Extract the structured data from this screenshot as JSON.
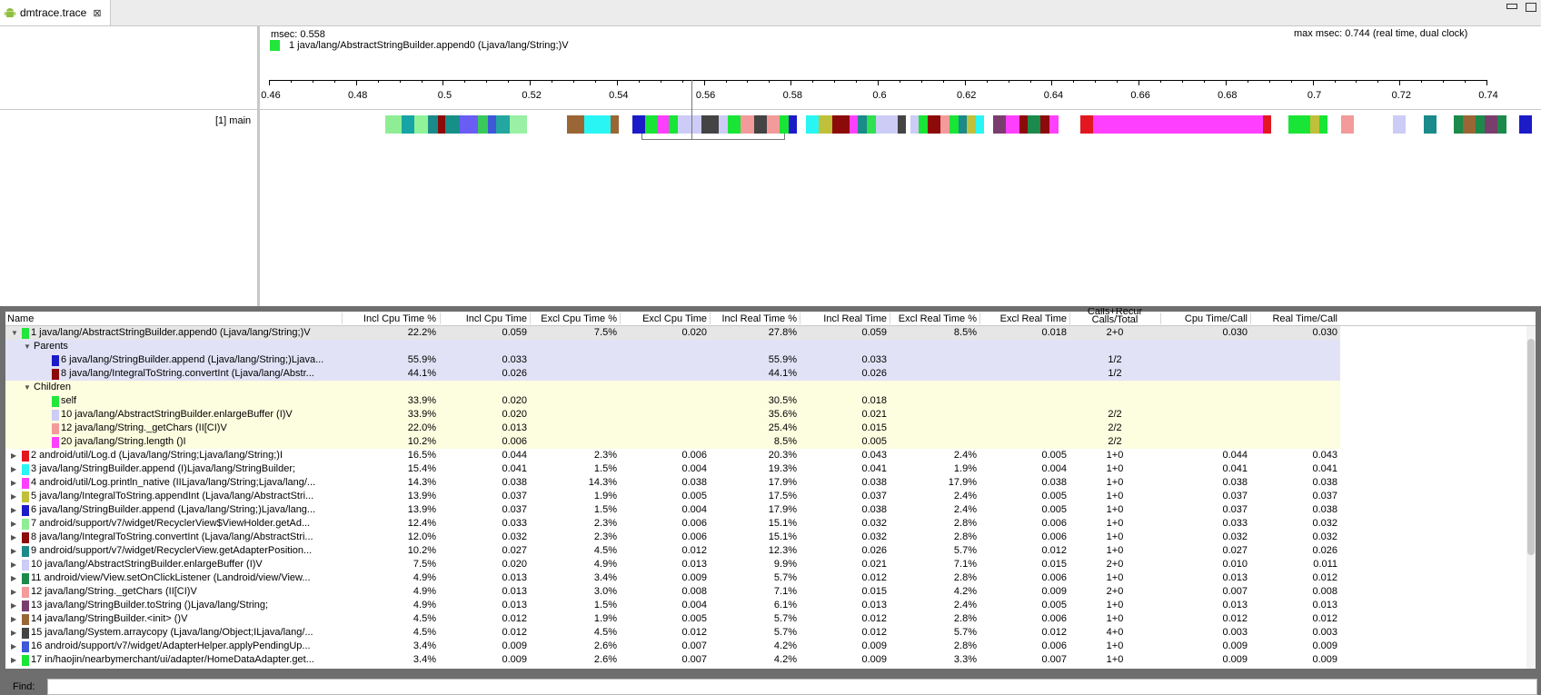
{
  "tab": {
    "title": "dmtrace.trace",
    "close": "⊠"
  },
  "header": {
    "msec": "msec: 0.558",
    "selected_color": "#22e63a",
    "selected_name": "1 java/lang/AbstractStringBuilder.append0 (Ljava/lang/String;)V",
    "max_msec": "max msec: 0.744 (real time, dual clock)"
  },
  "ruler_ticks": [
    "0.46",
    "0.48",
    "0.5",
    "0.52",
    "0.54",
    "0.56",
    "0.58",
    "0.6",
    "0.62",
    "0.64",
    "0.66",
    "0.68",
    "0.7",
    "0.72",
    "0.74"
  ],
  "thread_label": "[1] main",
  "segments": [
    [
      0.4868,
      0.4905,
      "#8fee93"
    ],
    [
      0.4905,
      0.4935,
      "#17a4a4"
    ],
    [
      0.4935,
      0.4965,
      "#90f39a"
    ],
    [
      0.4965,
      0.4988,
      "#1b8a8a"
    ],
    [
      0.4988,
      0.5005,
      "#8d0a0a"
    ],
    [
      0.5005,
      0.5038,
      "#168f88"
    ],
    [
      0.5038,
      0.508,
      "#6a5df3"
    ],
    [
      0.508,
      0.5103,
      "#39c95a"
    ],
    [
      0.5103,
      0.5123,
      "#3e58d8"
    ],
    [
      0.5123,
      0.5153,
      "#23a7a0"
    ],
    [
      0.5153,
      0.5193,
      "#9af0a4"
    ],
    [
      0.5285,
      0.5325,
      "#9a6635"
    ],
    [
      0.5325,
      0.5385,
      "#2af5f5"
    ],
    [
      0.5385,
      0.5405,
      "#9a6635"
    ],
    [
      0.5435,
      0.5465,
      "#1b1bc8"
    ],
    [
      0.5465,
      0.5495,
      "#18e535"
    ],
    [
      0.5495,
      0.552,
      "#ff3fff"
    ],
    [
      0.552,
      0.554,
      "#18e535"
    ],
    [
      0.554,
      0.5565,
      "#ccccf6"
    ],
    [
      0.5565,
      0.5595,
      "#ccccf6"
    ],
    [
      0.5595,
      0.5635,
      "#444444"
    ],
    [
      0.5635,
      0.5655,
      "#ccccf6"
    ],
    [
      0.5655,
      0.5685,
      "#18e535"
    ],
    [
      0.5685,
      0.5715,
      "#f39a9a"
    ],
    [
      0.5715,
      0.5745,
      "#444444"
    ],
    [
      0.5745,
      0.5775,
      "#f39a9a"
    ],
    [
      0.5775,
      0.5795,
      "#18e535"
    ],
    [
      0.5795,
      0.5815,
      "#1b1bc8"
    ],
    [
      0.5835,
      0.5865,
      "#2af5f5"
    ],
    [
      0.5865,
      0.5895,
      "#c0c03a"
    ],
    [
      0.5895,
      0.5935,
      "#8d0a0a"
    ],
    [
      0.5935,
      0.5955,
      "#ff3fff"
    ],
    [
      0.5955,
      0.5975,
      "#1b8a8a"
    ],
    [
      0.5975,
      0.5995,
      "#30e050"
    ],
    [
      0.5995,
      0.6045,
      "#ccccf6"
    ],
    [
      0.6045,
      0.6065,
      "#444444"
    ],
    [
      0.6075,
      0.6095,
      "#ccccf6"
    ],
    [
      0.6095,
      0.6115,
      "#18e535"
    ],
    [
      0.6115,
      0.6145,
      "#8d0a0a"
    ],
    [
      0.6145,
      0.6165,
      "#f39a9a"
    ],
    [
      0.6165,
      0.6185,
      "#18e535"
    ],
    [
      0.6185,
      0.6205,
      "#1b8a8a"
    ],
    [
      0.6205,
      0.6225,
      "#c0c03a"
    ],
    [
      0.6225,
      0.6245,
      "#2af5f5"
    ],
    [
      0.6265,
      0.6295,
      "#7a3e6e"
    ],
    [
      0.6295,
      0.6325,
      "#ff3fff"
    ],
    [
      0.6325,
      0.6345,
      "#8d0a0a"
    ],
    [
      0.6345,
      0.6375,
      "#1b8a4a"
    ],
    [
      0.6375,
      0.6395,
      "#8d0a0a"
    ],
    [
      0.6395,
      0.6415,
      "#ff3fff"
    ],
    [
      0.6465,
      0.6495,
      "#e2171f"
    ],
    [
      0.6495,
      0.6885,
      "#ff3fff"
    ],
    [
      0.6885,
      0.6905,
      "#e2171f"
    ],
    [
      0.6945,
      0.6995,
      "#18e535"
    ],
    [
      0.6995,
      0.7015,
      "#c0c03a"
    ],
    [
      0.7015,
      0.7035,
      "#18e535"
    ],
    [
      0.7065,
      0.7095,
      "#f39a9a"
    ],
    [
      0.7185,
      0.7215,
      "#ccccf6"
    ],
    [
      0.7255,
      0.7285,
      "#1b8a8a"
    ],
    [
      0.7325,
      0.7345,
      "#1b8a4a"
    ],
    [
      0.7345,
      0.7375,
      "#9a6635"
    ],
    [
      0.7375,
      0.7395,
      "#1b8a4a"
    ],
    [
      0.7395,
      0.7425,
      "#7a3e6e"
    ],
    [
      0.7425,
      0.7445,
      "#1b8a4a"
    ],
    [
      0.7475,
      0.7505,
      "#1b1bc8"
    ]
  ],
  "columns": {
    "name": "Name",
    "incl_cpu_pct": "Incl Cpu Time %",
    "incl_cpu": "Incl Cpu Time",
    "excl_cpu_pct": "Excl Cpu Time %",
    "excl_cpu": "Excl Cpu Time",
    "incl_real_pct": "Incl Real Time %",
    "incl_real": "Incl Real Time",
    "excl_real_pct": "Excl Real Time %",
    "excl_real": "Excl Real Time",
    "calls_line1": "Calls+Recur",
    "calls_line2": "Calls/Total",
    "cpu_per_call": "Cpu Time/Call",
    "real_per_call": "Real Time/Call"
  },
  "rows": [
    {
      "kind": "expanded",
      "bg": "#e6e6e6",
      "indent": 0,
      "color": "#22e63a",
      "name": "1 java/lang/AbstractStringBuilder.append0 (Ljava/lang/String;)V",
      "v": [
        "22.2%",
        "0.059",
        "7.5%",
        "0.020",
        "27.8%",
        "0.059",
        "8.5%",
        "0.018",
        "2+0",
        "0.030",
        "0.030"
      ]
    },
    {
      "kind": "group",
      "bg": "#e2e2f7",
      "indent": 1,
      "color": "",
      "name": "Parents",
      "v": [
        "",
        "",
        "",
        "",
        "",
        "",
        "",
        "",
        "",
        "",
        ""
      ]
    },
    {
      "kind": "leaf",
      "bg": "#e2e2f7",
      "indent": 2,
      "color": "#1b1bc8",
      "name": "6 java/lang/StringBuilder.append (Ljava/lang/String;)Ljava...",
      "v": [
        "55.9%",
        "0.033",
        "",
        "",
        "55.9%",
        "0.033",
        "",
        "",
        "1/2",
        "",
        ""
      ]
    },
    {
      "kind": "leaf",
      "bg": "#e2e2f7",
      "indent": 2,
      "color": "#8d0a0a",
      "name": "8 java/lang/IntegralToString.convertInt (Ljava/lang/Abstr...",
      "v": [
        "44.1%",
        "0.026",
        "",
        "",
        "44.1%",
        "0.026",
        "",
        "",
        "1/2",
        "",
        ""
      ]
    },
    {
      "kind": "group",
      "bg": "#fdfde0",
      "indent": 1,
      "color": "",
      "name": "Children",
      "v": [
        "",
        "",
        "",
        "",
        "",
        "",
        "",
        "",
        "",
        "",
        ""
      ]
    },
    {
      "kind": "leaf",
      "bg": "#fdfde0",
      "indent": 2,
      "color": "#22e63a",
      "name": "self",
      "v": [
        "33.9%",
        "0.020",
        "",
        "",
        "30.5%",
        "0.018",
        "",
        "",
        "",
        "",
        ""
      ]
    },
    {
      "kind": "leaf",
      "bg": "#fdfde0",
      "indent": 2,
      "color": "#ccccf6",
      "name": "10 java/lang/AbstractStringBuilder.enlargeBuffer (I)V",
      "v": [
        "33.9%",
        "0.020",
        "",
        "",
        "35.6%",
        "0.021",
        "",
        "",
        "2/2",
        "",
        ""
      ]
    },
    {
      "kind": "leaf",
      "bg": "#fdfde0",
      "indent": 2,
      "color": "#f39a9a",
      "name": "12 java/lang/String._getChars (II[CI)V",
      "v": [
        "22.0%",
        "0.013",
        "",
        "",
        "25.4%",
        "0.015",
        "",
        "",
        "2/2",
        "",
        ""
      ]
    },
    {
      "kind": "leaf",
      "bg": "#fdfde0",
      "indent": 2,
      "color": "#ff3fff",
      "name": "20 java/lang/String.length ()I",
      "v": [
        "10.2%",
        "0.006",
        "",
        "",
        "8.5%",
        "0.005",
        "",
        "",
        "2/2",
        "",
        ""
      ]
    },
    {
      "kind": "collapsed",
      "bg": "#ffffff",
      "indent": 0,
      "color": "#e2171f",
      "name": "2 android/util/Log.d (Ljava/lang/String;Ljava/lang/String;)I",
      "v": [
        "16.5%",
        "0.044",
        "2.3%",
        "0.006",
        "20.3%",
        "0.043",
        "2.4%",
        "0.005",
        "1+0",
        "0.044",
        "0.043"
      ]
    },
    {
      "kind": "collapsed",
      "bg": "#ffffff",
      "indent": 0,
      "color": "#2af5f5",
      "name": "3 java/lang/StringBuilder.append (I)Ljava/lang/StringBuilder;",
      "v": [
        "15.4%",
        "0.041",
        "1.5%",
        "0.004",
        "19.3%",
        "0.041",
        "1.9%",
        "0.004",
        "1+0",
        "0.041",
        "0.041"
      ]
    },
    {
      "kind": "collapsed",
      "bg": "#ffffff",
      "indent": 0,
      "color": "#ff3fff",
      "name": "4 android/util/Log.println_native (IILjava/lang/String;Ljava/lang/...",
      "v": [
        "14.3%",
        "0.038",
        "14.3%",
        "0.038",
        "17.9%",
        "0.038",
        "17.9%",
        "0.038",
        "1+0",
        "0.038",
        "0.038"
      ]
    },
    {
      "kind": "collapsed",
      "bg": "#ffffff",
      "indent": 0,
      "color": "#c0c03a",
      "name": "5 java/lang/IntegralToString.appendInt (Ljava/lang/AbstractStri...",
      "v": [
        "13.9%",
        "0.037",
        "1.9%",
        "0.005",
        "17.5%",
        "0.037",
        "2.4%",
        "0.005",
        "1+0",
        "0.037",
        "0.037"
      ]
    },
    {
      "kind": "collapsed",
      "bg": "#ffffff",
      "indent": 0,
      "color": "#1b1bc8",
      "name": "6 java/lang/StringBuilder.append (Ljava/lang/String;)Ljava/lang...",
      "v": [
        "13.9%",
        "0.037",
        "1.5%",
        "0.004",
        "17.9%",
        "0.038",
        "2.4%",
        "0.005",
        "1+0",
        "0.037",
        "0.038"
      ]
    },
    {
      "kind": "collapsed",
      "bg": "#ffffff",
      "indent": 0,
      "color": "#8fee93",
      "name": "7 android/support/v7/widget/RecyclerView$ViewHolder.getAd...",
      "v": [
        "12.4%",
        "0.033",
        "2.3%",
        "0.006",
        "15.1%",
        "0.032",
        "2.8%",
        "0.006",
        "1+0",
        "0.033",
        "0.032"
      ]
    },
    {
      "kind": "collapsed",
      "bg": "#ffffff",
      "indent": 0,
      "color": "#8d0a0a",
      "name": "8 java/lang/IntegralToString.convertInt (Ljava/lang/AbstractStri...",
      "v": [
        "12.0%",
        "0.032",
        "2.3%",
        "0.006",
        "15.1%",
        "0.032",
        "2.8%",
        "0.006",
        "1+0",
        "0.032",
        "0.032"
      ]
    },
    {
      "kind": "collapsed",
      "bg": "#ffffff",
      "indent": 0,
      "color": "#1b8a8a",
      "name": "9 android/support/v7/widget/RecyclerView.getAdapterPosition...",
      "v": [
        "10.2%",
        "0.027",
        "4.5%",
        "0.012",
        "12.3%",
        "0.026",
        "5.7%",
        "0.012",
        "1+0",
        "0.027",
        "0.026"
      ]
    },
    {
      "kind": "collapsed",
      "bg": "#ffffff",
      "indent": 0,
      "color": "#ccccf6",
      "name": "10 java/lang/AbstractStringBuilder.enlargeBuffer (I)V",
      "v": [
        "7.5%",
        "0.020",
        "4.9%",
        "0.013",
        "9.9%",
        "0.021",
        "7.1%",
        "0.015",
        "2+0",
        "0.010",
        "0.011"
      ]
    },
    {
      "kind": "collapsed",
      "bg": "#ffffff",
      "indent": 0,
      "color": "#1b8a4a",
      "name": "11 android/view/View.setOnClickListener (Landroid/view/View...",
      "v": [
        "4.9%",
        "0.013",
        "3.4%",
        "0.009",
        "5.7%",
        "0.012",
        "2.8%",
        "0.006",
        "1+0",
        "0.013",
        "0.012"
      ]
    },
    {
      "kind": "collapsed",
      "bg": "#ffffff",
      "indent": 0,
      "color": "#f39a9a",
      "name": "12 java/lang/String._getChars (II[CI)V",
      "v": [
        "4.9%",
        "0.013",
        "3.0%",
        "0.008",
        "7.1%",
        "0.015",
        "4.2%",
        "0.009",
        "2+0",
        "0.007",
        "0.008"
      ]
    },
    {
      "kind": "collapsed",
      "bg": "#ffffff",
      "indent": 0,
      "color": "#7a3e6e",
      "name": "13 java/lang/StringBuilder.toString ()Ljava/lang/String;",
      "v": [
        "4.9%",
        "0.013",
        "1.5%",
        "0.004",
        "6.1%",
        "0.013",
        "2.4%",
        "0.005",
        "1+0",
        "0.013",
        "0.013"
      ]
    },
    {
      "kind": "collapsed",
      "bg": "#ffffff",
      "indent": 0,
      "color": "#9a6635",
      "name": "14 java/lang/StringBuilder.<init> ()V",
      "v": [
        "4.5%",
        "0.012",
        "1.9%",
        "0.005",
        "5.7%",
        "0.012",
        "2.8%",
        "0.006",
        "1+0",
        "0.012",
        "0.012"
      ]
    },
    {
      "kind": "collapsed",
      "bg": "#ffffff",
      "indent": 0,
      "color": "#444444",
      "name": "15 java/lang/System.arraycopy (Ljava/lang/Object;ILjava/lang/...",
      "v": [
        "4.5%",
        "0.012",
        "4.5%",
        "0.012",
        "5.7%",
        "0.012",
        "5.7%",
        "0.012",
        "4+0",
        "0.003",
        "0.003"
      ]
    },
    {
      "kind": "collapsed",
      "bg": "#ffffff",
      "indent": 0,
      "color": "#3e58d8",
      "name": "16 android/support/v7/widget/AdapterHelper.applyPendingUp...",
      "v": [
        "3.4%",
        "0.009",
        "2.6%",
        "0.007",
        "4.2%",
        "0.009",
        "2.8%",
        "0.006",
        "1+0",
        "0.009",
        "0.009"
      ]
    },
    {
      "kind": "collapsed",
      "bg": "#ffffff",
      "indent": 0,
      "color": "#18e535",
      "name": "17 in/haojin/nearbymerchant/ui/adapter/HomeDataAdapter.get...",
      "v": [
        "3.4%",
        "0.009",
        "2.6%",
        "0.007",
        "4.2%",
        "0.009",
        "3.3%",
        "0.007",
        "1+0",
        "0.009",
        "0.009"
      ]
    }
  ],
  "find": {
    "label": "Find:",
    "value": ""
  }
}
